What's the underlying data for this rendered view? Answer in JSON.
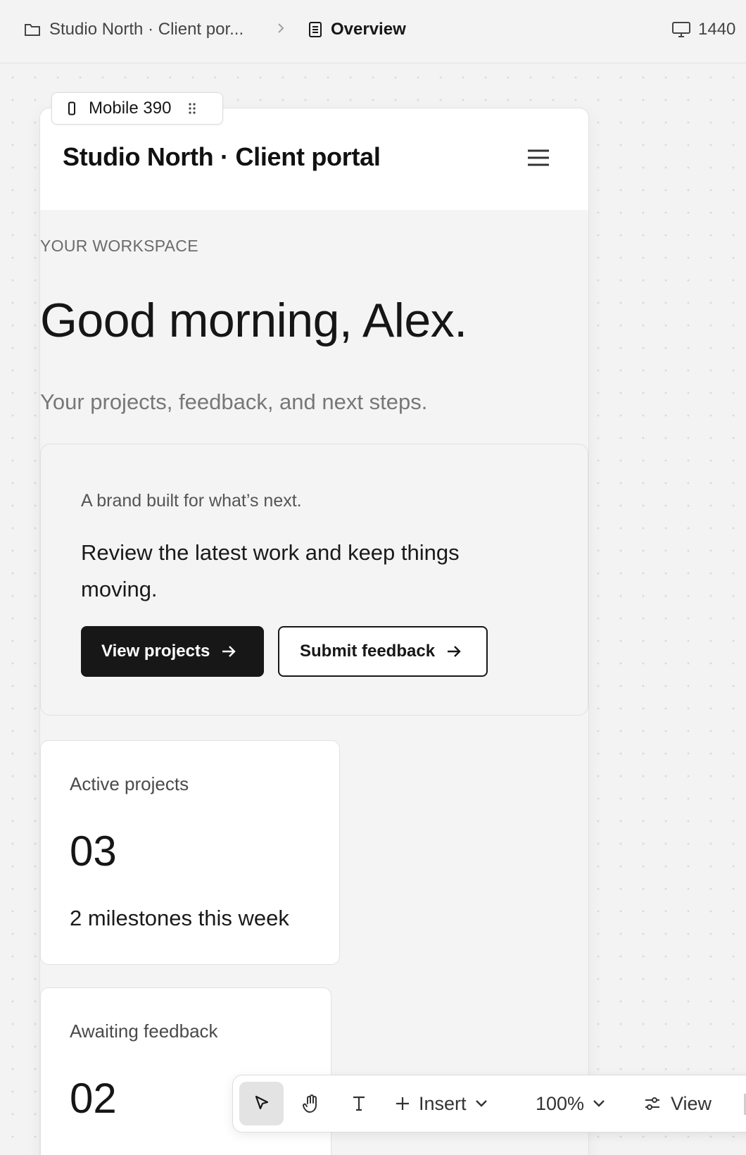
{
  "topbar": {
    "project_crumb": "Studio North · Client por...",
    "page_crumb": "Overview",
    "viewport_width": "1440"
  },
  "frame": {
    "tag_label": "Mobile 390"
  },
  "app": {
    "title": "Studio North · Client portal",
    "eyebrow": "YOUR WORKSPACE",
    "greeting": "Good morning, Alex.",
    "subtitle": "Your projects, feedback, and next steps.",
    "hero": {
      "kicker": "A brand built for what’s next.",
      "body": "Review the latest work and keep things moving.",
      "primary_button": "View projects",
      "secondary_button": "Submit feedback"
    },
    "stats": [
      {
        "label": "Active projects",
        "value": "03",
        "note": "2 milestones this week"
      },
      {
        "label": "Awaiting feedback",
        "value": "02"
      }
    ]
  },
  "toolbar": {
    "insert_label": "Insert",
    "zoom_label": "100%",
    "view_label": "View"
  }
}
